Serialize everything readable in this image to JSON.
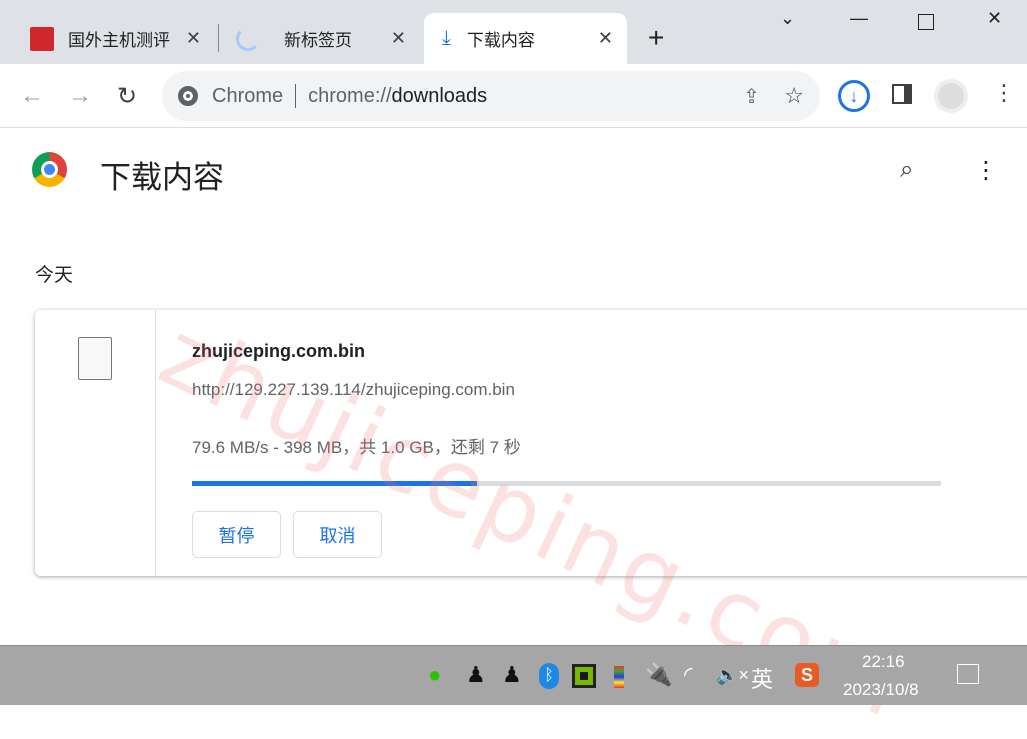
{
  "tabs": [
    {
      "label": "国外主机测评",
      "icon": "site-favicon",
      "active": false
    },
    {
      "label": "新标签页",
      "icon": "loading-spinner",
      "active": false
    },
    {
      "label": "下载内容",
      "icon": "download-icon",
      "active": true
    }
  ],
  "address": {
    "origin": "Chrome",
    "url_prefix": "chrome://",
    "url_path": "downloads"
  },
  "page": {
    "title": "下载内容",
    "section": "今天"
  },
  "download": {
    "filename": "zhujiceping.com.bin",
    "url": "http://129.227.139.114/zhujiceping.com.bin",
    "status": "79.6 MB/s - 398 MB，共 1.0 GB，还剩 7 秒",
    "progress": 0.38,
    "pause_label": "暂停",
    "cancel_label": "取消"
  },
  "taskbar": {
    "time": "22:16",
    "date": "2023/10/8",
    "ime": "英"
  },
  "watermark": "zhujiceping.com",
  "colors": {
    "accent": "#1a73e8",
    "progress_track": "#dadce0"
  }
}
